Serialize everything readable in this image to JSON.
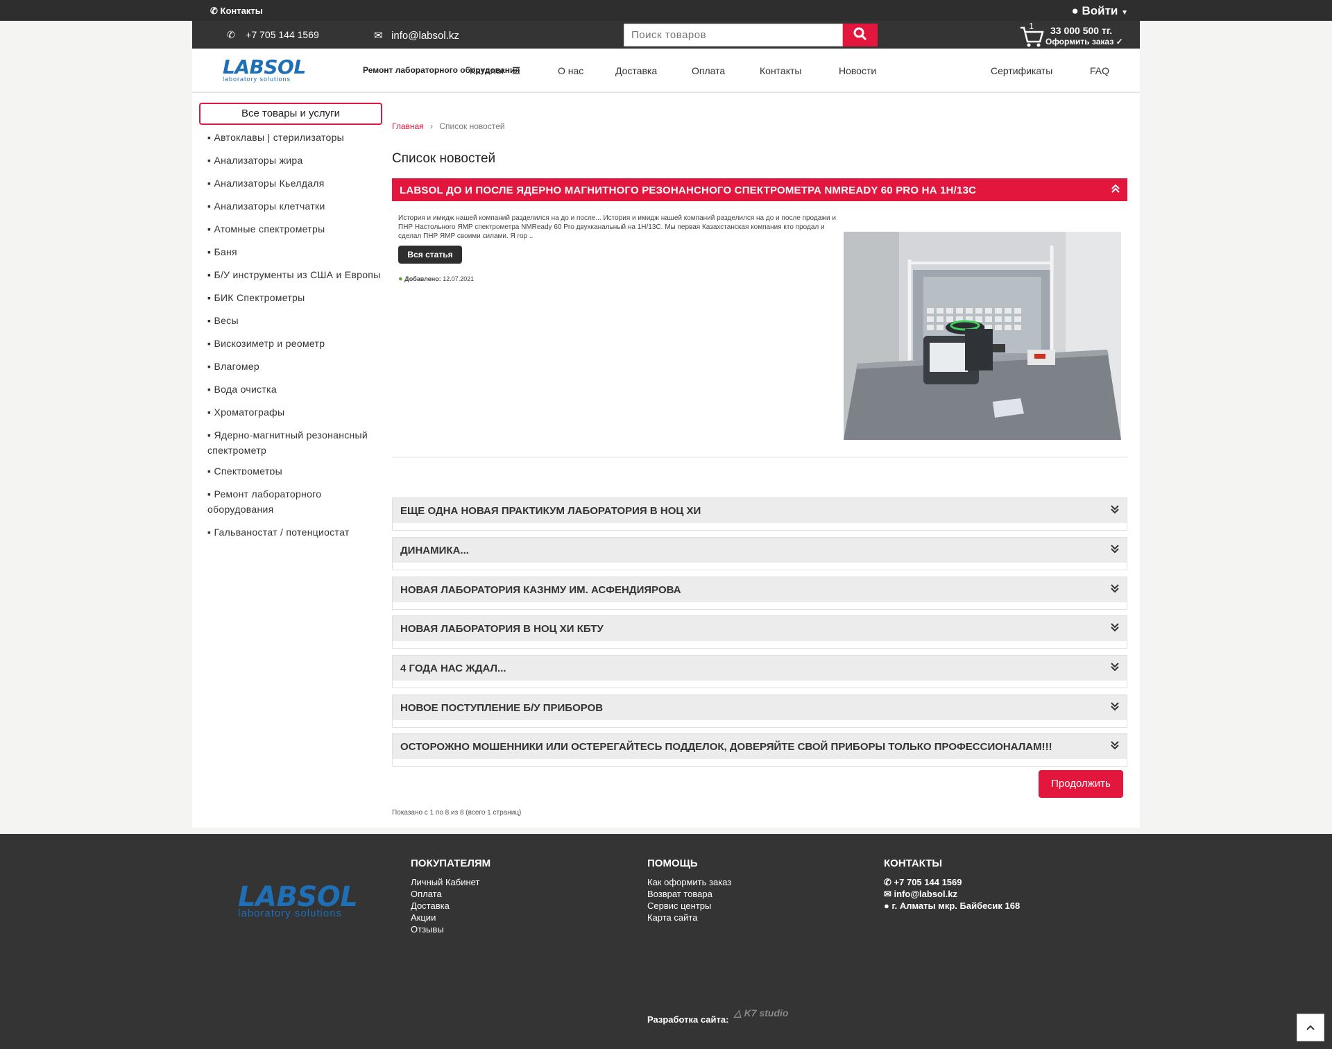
{
  "topbar": {
    "contacts": "Контакты",
    "login": "Войти"
  },
  "secbar": {
    "phone": "+7 705 144 1569",
    "email": "info@labsol.kz",
    "search_placeholder": "Поиск товаров",
    "cart_count": "1",
    "cart_sum": "33 000 500 тг.",
    "cart_checkout": "Оформить заказ ✓"
  },
  "logo": {
    "word": "LABSOL",
    "sub": "laboratory solutions"
  },
  "nav": {
    "repair": "Ремонт лабораторного оборудования",
    "catalog": "Каталог",
    "about": "О нас",
    "delivery": "Доставка",
    "payment": "Оплата",
    "contacts": "Контакты",
    "news": "Новости",
    "certificates": "Сертификаты",
    "faq": "FAQ"
  },
  "sidebar": {
    "all": "Все товары и услуги",
    "items": [
      "▪ Автоклавы | стерилизаторы",
      "▪ Анализаторы жира",
      "▪ Анализаторы Кьелдаля",
      "▪ Анализаторы клетчатки",
      "▪ Атомные спектрометры",
      "▪ Баня",
      "▪ Б/У инструменты из США и Европы",
      "▪ БИК Спектрометры",
      "▪ Весы",
      "▪ Вискозиметр и реометр",
      "▪ Влагомер",
      "▪ Вода очистка",
      "▪ Хроматографы",
      "▪ Ядерно-магнитный резонансный спектрометр",
      "▪ Спектрометры",
      "▪ Ремонт лабораторного оборудования",
      "▪ Гальваностат / потенциостат"
    ]
  },
  "breadcrumb": {
    "home": "Главная",
    "sep": "›",
    "current": "Список новостей"
  },
  "page_title": "Список новостей",
  "open_article": {
    "title": "LABSOL ДО И ПОСЛЕ ЯДЕРНО МАГНИТНОГО РЕЗОНАНСНОГО СПЕКТРОМЕТРА NMREADY 60 PRO НА 1H/13C",
    "excerpt": "История и имидж нашей компаний разделился на до и после... История и имидж нашей компаний разделился на до и после продажи и ПНР Настольного ЯМР спектрометра NMReady 60 Pro двухканальный на 1H/13C. Мы первая Казахстанская компания кто продал и сделал ПНР ЯМР своими силами. Я гор ..",
    "read_more": "Вся статья",
    "added_label": "Добавлено:",
    "added_date": "12.07.2021"
  },
  "articles": [
    "ЕЩЕ ОДНА НОВАЯ ПРАКТИКУМ ЛАБОРАТОРИЯ В НОЦ ХИ",
    "ДИНАМИКА...",
    "НОВАЯ ЛАБОРАТОРИЯ КАЗНМУ ИМ. АСФЕНДИЯРОВА",
    "НОВАЯ ЛАБОРАТОРИЯ В НОЦ ХИ КБТУ",
    "4 ГОДА НАС ЖДАЛ...",
    "НОВОЕ ПОСТУПЛЕНИЕ Б/У ПРИБОРОВ",
    "ОСТОРОЖНО МОШЕННИКИ ИЛИ ОСТЕРЕГАЙТЕСЬ ПОДДЕЛОК, ДОВЕРЯЙТЕ СВОЙ ПРИБОРЫ ТОЛЬКО ПРОФЕССИОНАЛАМ!!!"
  ],
  "continue": "Продолжить",
  "shown": "Показано с 1 по 8 из 8 (всего 1 страниц)",
  "footer": {
    "buyers_title": "ПОКУПАТЕЛЯМ",
    "buyers": [
      "Личный Кабинет",
      "Оплата",
      "Доставка",
      "Акции",
      "Отзывы"
    ],
    "help_title": "ПОМОЩЬ",
    "help": [
      "Как оформить заказ",
      "Возврат товара",
      "Сервис центры",
      "Карта сайта"
    ],
    "contacts_title": "КОНТАКТЫ",
    "phone": "+7 705 144 1569",
    "email": "info@labsol.kz",
    "address": "г. Алматы мкр. Байбесик 168",
    "dev_label": "Разработка сайта:",
    "dev_studio": "K7 studio"
  },
  "colors": {
    "accent": "#e3173e",
    "dark": "#2e2e2e",
    "brand_blue": "#1e6fb6",
    "brand_orange": "#f0a020"
  }
}
